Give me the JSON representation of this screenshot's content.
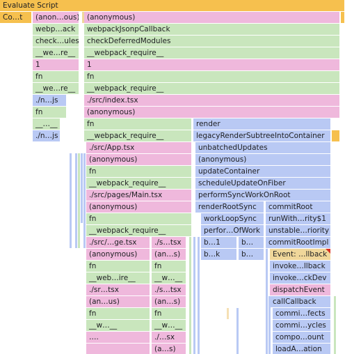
{
  "rows": [
    {
      "frames": [
        {
          "label": "Evaluate Script",
          "color": "y",
          "l": 0,
          "w": 496,
          "interactable": true
        }
      ]
    },
    {
      "frames": [
        {
          "label": "Co…t",
          "color": "y",
          "l": 0,
          "w": 46,
          "interactable": true
        },
        {
          "label": "(anon…ous)",
          "color": "p",
          "l": 47,
          "w": 67,
          "interactable": true
        },
        {
          "label": "(anonymous)",
          "color": "p",
          "l": 121,
          "w": 368,
          "interactable": true
        },
        {
          "label": "",
          "color": "y",
          "l": 490,
          "w": 6,
          "interactable": true
        }
      ]
    },
    {
      "frames": [
        {
          "label": "webp…ack",
          "color": "g",
          "l": 47,
          "w": 67,
          "interactable": true
        },
        {
          "label": "webpackJsonpCallback",
          "color": "g",
          "l": 121,
          "w": 368,
          "interactable": true
        }
      ]
    },
    {
      "frames": [
        {
          "label": "check…ules",
          "color": "g",
          "l": 47,
          "w": 67,
          "interactable": true
        },
        {
          "label": "checkDeferredModules",
          "color": "g",
          "l": 121,
          "w": 368,
          "interactable": true
        }
      ]
    },
    {
      "frames": [
        {
          "label": "__we…re__",
          "color": "g",
          "l": 47,
          "w": 67,
          "interactable": true
        },
        {
          "label": "__webpack_require__",
          "color": "g",
          "l": 121,
          "w": 368,
          "interactable": true
        }
      ]
    },
    {
      "frames": [
        {
          "label": "1",
          "color": "p",
          "l": 47,
          "w": 67,
          "interactable": true
        },
        {
          "label": "1",
          "color": "p",
          "l": 121,
          "w": 368,
          "interactable": true
        }
      ]
    },
    {
      "frames": [
        {
          "label": "fn",
          "color": "g",
          "l": 47,
          "w": 67,
          "interactable": true
        },
        {
          "label": "fn",
          "color": "g",
          "l": 121,
          "w": 368,
          "interactable": true
        }
      ]
    },
    {
      "frames": [
        {
          "label": "__we…re__",
          "color": "g",
          "l": 47,
          "w": 67,
          "interactable": true
        },
        {
          "label": "__webpack_require__",
          "color": "g",
          "l": 121,
          "w": 368,
          "interactable": true
        }
      ]
    },
    {
      "frames": [
        {
          "label": "./n…js",
          "color": "b",
          "l": 47,
          "w": 49,
          "interactable": true
        },
        {
          "label": "./src/index.tsx",
          "color": "p",
          "l": 121,
          "w": 368,
          "interactable": true
        }
      ]
    },
    {
      "frames": [
        {
          "label": "fn",
          "color": "g",
          "l": 47,
          "w": 49,
          "interactable": true
        },
        {
          "label": "(anonymous)",
          "color": "p",
          "l": 121,
          "w": 368,
          "interactable": true
        }
      ]
    },
    {
      "frames": [
        {
          "label": "__…__",
          "color": "g",
          "l": 47,
          "w": 40,
          "interactable": true
        },
        {
          "label": "fn",
          "color": "g",
          "l": 121,
          "w": 155,
          "interactable": true
        },
        {
          "label": "render",
          "color": "b",
          "l": 278,
          "w": 198,
          "interactable": true
        }
      ]
    },
    {
      "frames": [
        {
          "label": "./n…js",
          "color": "b",
          "l": 47,
          "w": 40,
          "interactable": true
        },
        {
          "label": "__webpack_require__",
          "color": "g",
          "l": 121,
          "w": 155,
          "interactable": true
        },
        {
          "label": "legacyRenderSubtreeIntoContainer",
          "color": "b",
          "l": 278,
          "w": 198,
          "interactable": true
        },
        {
          "label": "",
          "color": "y",
          "l": 477,
          "w": 12,
          "interactable": true
        }
      ]
    },
    {
      "frames": [
        {
          "label": "./src/App.tsx",
          "color": "p",
          "l": 124,
          "w": 152,
          "interactable": true
        },
        {
          "label": "unbatchedUpdates",
          "color": "b",
          "l": 281,
          "w": 195,
          "interactable": true
        }
      ]
    },
    {
      "frames": [
        {
          "label": "(anonymous)",
          "color": "p",
          "l": 124,
          "w": 152,
          "interactable": true
        },
        {
          "label": "(anonymous)",
          "color": "b",
          "l": 281,
          "w": 195,
          "interactable": true
        }
      ]
    },
    {
      "frames": [
        {
          "label": "fn",
          "color": "g",
          "l": 124,
          "w": 152,
          "interactable": true
        },
        {
          "label": "updateContainer",
          "color": "b",
          "l": 281,
          "w": 195,
          "interactable": true
        }
      ]
    },
    {
      "frames": [
        {
          "label": "__webpack_require__",
          "color": "g",
          "l": 124,
          "w": 152,
          "interactable": true
        },
        {
          "label": "scheduleUpdateOnFiber",
          "color": "b",
          "l": 281,
          "w": 195,
          "interactable": true
        }
      ]
    },
    {
      "frames": [
        {
          "label": "./src/pages/Main.tsx",
          "color": "p",
          "l": 124,
          "w": 152,
          "interactable": true
        },
        {
          "label": "performSyncWorkOnRoot",
          "color": "b",
          "l": 281,
          "w": 195,
          "interactable": true
        }
      ]
    },
    {
      "frames": [
        {
          "label": "(anonymous)",
          "color": "p",
          "l": 124,
          "w": 152,
          "interactable": true
        },
        {
          "label": "renderRootSync",
          "color": "b",
          "l": 281,
          "w": 99,
          "interactable": true
        },
        {
          "label": "commitRoot",
          "color": "b",
          "l": 382,
          "w": 94,
          "interactable": true
        }
      ]
    },
    {
      "frames": [
        {
          "label": "fn",
          "color": "g",
          "l": 124,
          "w": 152,
          "interactable": true
        },
        {
          "label": "workLoopSync",
          "color": "b",
          "l": 289,
          "w": 91,
          "interactable": true
        },
        {
          "label": "runWith…rity$1",
          "color": "b",
          "l": 382,
          "w": 94,
          "interactable": true
        }
      ]
    },
    {
      "frames": [
        {
          "label": "__webpack_require__",
          "color": "g",
          "l": 124,
          "w": 152,
          "interactable": true
        },
        {
          "label": "perfor…OfWork",
          "color": "b",
          "l": 289,
          "w": 91,
          "interactable": true
        },
        {
          "label": "unstable…riority",
          "color": "b",
          "l": 382,
          "w": 94,
          "interactable": true
        }
      ]
    },
    {
      "frames": [
        {
          "label": "./src/…ge.tsx",
          "color": "p",
          "l": 124,
          "w": 92,
          "interactable": true
        },
        {
          "label": "./s…tsx",
          "color": "p",
          "l": 218,
          "w": 50,
          "interactable": true
        },
        {
          "label": "b…1",
          "color": "b",
          "l": 289,
          "w": 52,
          "interactable": true
        },
        {
          "label": "b…",
          "color": "b",
          "l": 343,
          "w": 37,
          "interactable": true
        },
        {
          "label": "commitRootImpl",
          "color": "b",
          "l": 382,
          "w": 94,
          "interactable": true
        }
      ]
    },
    {
      "frames": [
        {
          "label": "(anonymous)",
          "color": "p",
          "l": 124,
          "w": 92,
          "interactable": true
        },
        {
          "label": "(an…s)",
          "color": "p",
          "l": 218,
          "w": 50,
          "interactable": true
        },
        {
          "label": "b…k",
          "color": "b",
          "l": 289,
          "w": 52,
          "interactable": true
        },
        {
          "label": "b…",
          "color": "b",
          "l": 343,
          "w": 37,
          "interactable": true
        },
        {
          "label": "Event: …llback",
          "color": "ysel",
          "l": 388,
          "w": 88,
          "interactable": true,
          "flag": true
        }
      ]
    },
    {
      "frames": [
        {
          "label": "fn",
          "color": "g",
          "l": 124,
          "w": 92,
          "interactable": true
        },
        {
          "label": "fn",
          "color": "g",
          "l": 218,
          "w": 50,
          "interactable": true
        },
        {
          "label": "invoke…llback",
          "color": "b",
          "l": 388,
          "w": 88,
          "interactable": true
        }
      ]
    },
    {
      "frames": [
        {
          "label": "__web…ire__",
          "color": "g",
          "l": 124,
          "w": 92,
          "interactable": true
        },
        {
          "label": "__w…__",
          "color": "g",
          "l": 218,
          "w": 50,
          "interactable": true
        },
        {
          "label": "invoke…ckDev",
          "color": "b",
          "l": 388,
          "w": 88,
          "interactable": true
        }
      ]
    },
    {
      "frames": [
        {
          "label": "./sr…tsx",
          "color": "p",
          "l": 124,
          "w": 92,
          "interactable": true
        },
        {
          "label": "./s…tsx",
          "color": "p",
          "l": 218,
          "w": 50,
          "interactable": true
        },
        {
          "label": "dispatchEvent",
          "color": "p",
          "l": 388,
          "w": 88,
          "interactable": true
        }
      ]
    },
    {
      "frames": [
        {
          "label": "(an…us)",
          "color": "p",
          "l": 124,
          "w": 92,
          "interactable": true
        },
        {
          "label": "(an…s)",
          "color": "p",
          "l": 218,
          "w": 50,
          "interactable": true
        },
        {
          "label": "callCallback",
          "color": "b",
          "l": 388,
          "w": 88,
          "interactable": true
        }
      ]
    },
    {
      "frames": [
        {
          "label": "fn",
          "color": "g",
          "l": 124,
          "w": 92,
          "interactable": true
        },
        {
          "label": "fn",
          "color": "g",
          "l": 218,
          "w": 50,
          "interactable": true
        },
        {
          "label": "commi…fects",
          "color": "b",
          "l": 392,
          "w": 84,
          "interactable": true
        }
      ]
    },
    {
      "frames": [
        {
          "label": "__w…__",
          "color": "g",
          "l": 124,
          "w": 92,
          "interactable": true
        },
        {
          "label": "__w…__",
          "color": "g",
          "l": 218,
          "w": 50,
          "interactable": true
        },
        {
          "label": "commi…ycles",
          "color": "b",
          "l": 392,
          "w": 84,
          "interactable": true
        }
      ]
    },
    {
      "frames": [
        {
          "label": "….",
          "color": "p",
          "l": 124,
          "w": 92,
          "interactable": true
        },
        {
          "label": "./…sx",
          "color": "p",
          "l": 218,
          "w": 50,
          "interactable": true
        },
        {
          "label": "compo…ount",
          "color": "b",
          "l": 392,
          "w": 84,
          "interactable": true
        }
      ]
    },
    {
      "frames": [
        {
          "label": "",
          "color": "p",
          "l": 124,
          "w": 92,
          "interactable": true
        },
        {
          "label": "(a…s)",
          "color": "p",
          "l": 218,
          "w": 50,
          "interactable": true
        },
        {
          "label": "loadA…ation",
          "color": "b",
          "l": 392,
          "w": 84,
          "interactable": true
        }
      ]
    }
  ]
}
